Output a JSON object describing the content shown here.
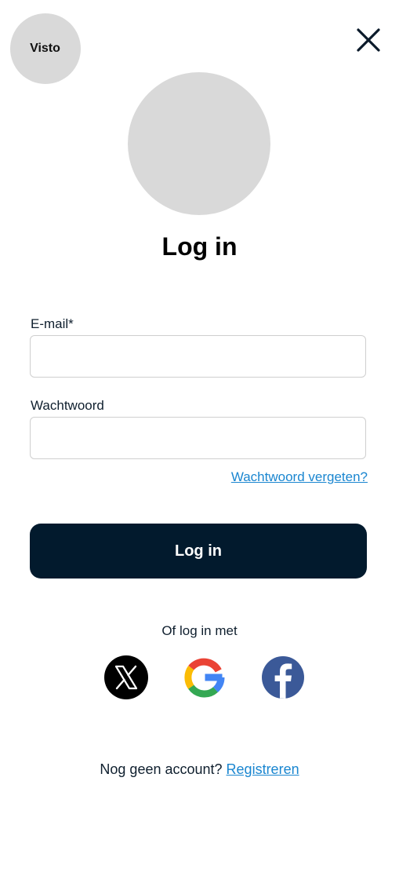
{
  "brand": {
    "logo_text": "Visto"
  },
  "header": {
    "close_icon": "close-icon"
  },
  "main": {
    "title": "Log in"
  },
  "form": {
    "email_label": "E-mail*",
    "email_value": "",
    "email_placeholder": "",
    "password_label": "Wachtwoord",
    "password_value": "",
    "password_placeholder": "",
    "forgot_password": "Wachtwoord vergeten?",
    "submit_label": "Log in"
  },
  "social": {
    "caption": "Of log in met",
    "providers": [
      {
        "name": "x",
        "icon": "x-logo-icon"
      },
      {
        "name": "google",
        "icon": "google-logo-icon"
      },
      {
        "name": "facebook",
        "icon": "facebook-logo-icon"
      }
    ]
  },
  "signup": {
    "prompt": "Nog geen account?",
    "link": "Registreren"
  },
  "colors": {
    "primary_dark": "#021a2d",
    "link_blue": "#1a86d0",
    "placeholder_gray": "#d9d9d9",
    "facebook_blue": "#3b5998"
  }
}
